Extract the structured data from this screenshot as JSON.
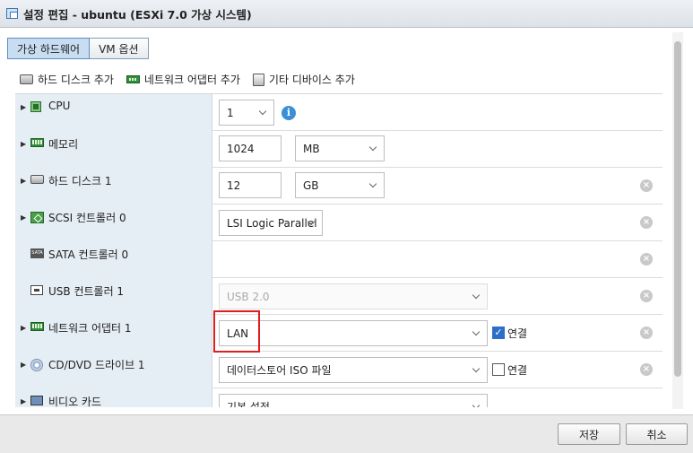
{
  "window": {
    "title": "설정 편집 - ubuntu (ESXi 7.0 가상 시스템)"
  },
  "tabs": [
    {
      "label": "가상 하드웨어",
      "active": true
    },
    {
      "label": "VM 옵션",
      "active": false
    }
  ],
  "toolbar": {
    "add_disk": "하드 디스크 추가",
    "add_nic": "네트워크 어댑터 추가",
    "add_other": "기타 디바이스 추가"
  },
  "hardware": {
    "cpu": {
      "label": "CPU",
      "value": "1"
    },
    "memory": {
      "label": "메모리",
      "value": "1024",
      "unit": "MB"
    },
    "disk": {
      "label": "하드 디스크 1",
      "value": "12",
      "unit": "GB"
    },
    "scsi": {
      "label": "SCSI 컨트롤러 0",
      "value": "LSI Logic Parallel"
    },
    "sata": {
      "label": "SATA 컨트롤러 0"
    },
    "usb": {
      "label": "USB 컨트롤러 1",
      "value": "USB 2.0"
    },
    "nic": {
      "label": "네트워크 어댑터 1",
      "value": "LAN",
      "connect_label": "연결",
      "connected": true
    },
    "cdrom": {
      "label": "CD/DVD 드라이브 1",
      "value": "데이터스토어 ISO 파일",
      "connect_label": "연결",
      "connected": false
    },
    "video": {
      "label": "비디오 카드",
      "value": "기본 설정"
    }
  },
  "sata_icon_text": "SATA",
  "footer": {
    "save_label": "저장",
    "cancel_label": "취소"
  },
  "colors": {
    "highlight": "#e02020",
    "active_tab": "#c8ddf2",
    "label_bg": "#e6eef5",
    "info": "#3c8fd6"
  }
}
